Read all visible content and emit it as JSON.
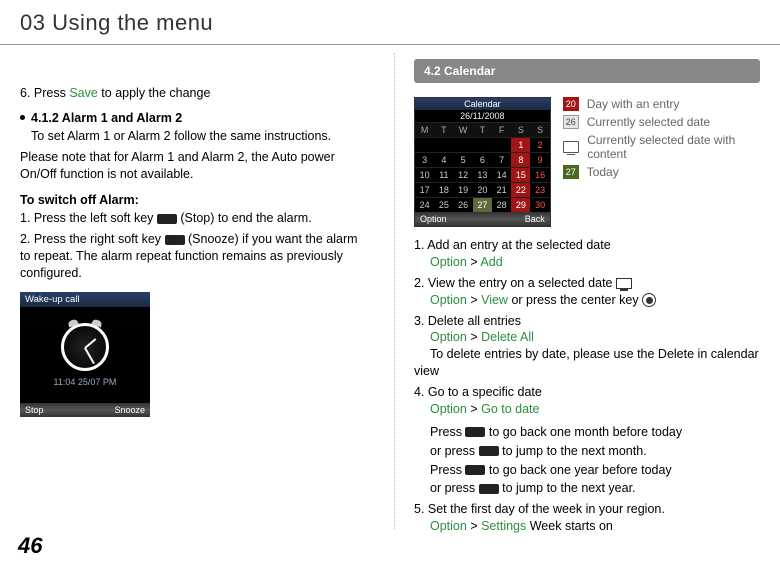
{
  "header": {
    "title": "03 Using the menu"
  },
  "page_number": "46",
  "left": {
    "step6_a": "6. Press ",
    "step6_link": "Save",
    "step6_b": " to apply the change",
    "sec412_title": "4.1.2  Alarm 1 and Alarm 2",
    "sec412_body": "To set Alarm 1 or Alarm 2 follow the same instructions.",
    "sec412_note": "Please note that for Alarm 1 and Alarm 2, the Auto power On/Off function is not available.",
    "switch_title": "To switch off Alarm:",
    "sw1_a": "1. Press the left soft key ",
    "sw1_b": " (Stop) to end the alarm.",
    "sw2_a": "2. Press the right soft key ",
    "sw2_b": " (Snooze) if you want the alarm to repeat. The alarm repeat function remains as previously configured.",
    "wake": {
      "title": "Wake-up call",
      "time": "11:04 25/07 PM",
      "left": "Stop",
      "right": "Snooze"
    }
  },
  "right": {
    "section_bar": "4.2  Calendar",
    "legend": {
      "entry": "Day with an entry",
      "selected": "Currently selected date",
      "selected_content": "Currently selected date with content",
      "today": "Today"
    },
    "cal": {
      "title": "Calendar",
      "date": "26/11/2008",
      "days": [
        "M",
        "T",
        "W",
        "T",
        "F",
        "S",
        "S"
      ],
      "optL": "Option",
      "optR": "Back"
    },
    "step1_a": "1. Add an entry at the selected date",
    "step1_link1": "Option",
    "step1_gt": " > ",
    "step1_link2": "Add",
    "step2_a": "2.  View the entry on a selected date ",
    "step2_link1": "Option",
    "step2_link2": "View",
    "step2_b": " or press the center key ",
    "step3_a": "3.  Delete all entries",
    "step3_link1": "Option",
    "step3_link2": "Delete All",
    "step3_b": "To delete entries by date, please use the Delete in calendar view",
    "step4_a": "4.  Go to a specific date",
    "step4_link1": "Option",
    "step4_link2": "Go to date",
    "step4_p1a": "Press ",
    "step4_p1b": " to go back one month before today",
    "step4_p2a": "or press ",
    "step4_p2b": " to jump to the next month.",
    "step4_p3a": "Press ",
    "step4_p3b": " to go back one year before today",
    "step4_p4a": "or press ",
    "step4_p4b": " to jump to the next year.",
    "step5_a": "5. Set the first day of the week in your region.",
    "step5_link1": "Option",
    "step5_link2": "Settings",
    "step5_b": " Week starts on",
    "leg_num1": "20",
    "leg_num2": "26",
    "leg_num3": "27"
  }
}
